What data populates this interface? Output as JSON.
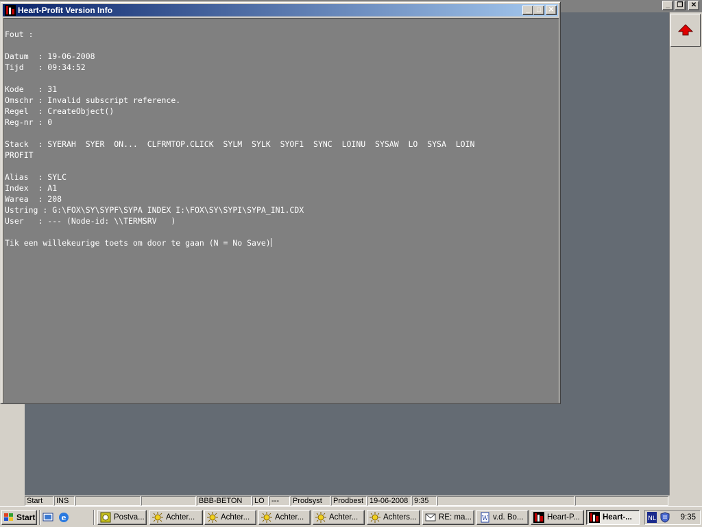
{
  "app": {
    "minimize_glyph": "_",
    "restore_glyph": "❐",
    "close_glyph": "✕"
  },
  "dialog": {
    "title": "Heart-Profit Version Info",
    "minimize_glyph": "_",
    "maximize_glyph": "□",
    "close_glyph": "✕",
    "lines": [
      "Fout :",
      "",
      "Datum  : 19-06-2008",
      "Tijd   : 09:34:52",
      "",
      "Kode   : 31",
      "Omschr : Invalid subscript reference.",
      "Regel  : CreateObject()",
      "Reg-nr : 0",
      "",
      "Stack  : SYERAH  SYER  ON...  CLFRMTOP.CLICK  SYLM  SYLK  SYOF1  SYNC  LOINU  SYSAW  LO  SYSA  LOIN",
      "PROFIT",
      "",
      "Alias  : SYLC",
      "Index  : A1",
      "Warea  : 208",
      "Ustring : G:\\FOX\\SY\\SYPF\\SYPA INDEX I:\\FOX\\SY\\SYPI\\SYPA_IN1.CDX",
      "User   : --- (Node-id: \\\\TERMSRV   )",
      "",
      "Tik een willekeurige toets om door te gaan (N = No Save)"
    ]
  },
  "statusbar": {
    "cells": [
      "Start",
      "INS",
      "",
      "",
      "BBB-BETON",
      "LO",
      "---",
      "Prodsyst",
      "Prodbest",
      "19-06-2008",
      "9:35",
      "",
      ""
    ]
  },
  "taskbar": {
    "start_label": "Start",
    "buttons": [
      "Postva...",
      "Achter...",
      "Achter...",
      "Achter...",
      "Achter...",
      "Achters...",
      "RE: ma...",
      "v.d. Bo...",
      "Heart-P...",
      "Heart-..."
    ],
    "clock": "9:35"
  },
  "colors": {
    "titlebar_start": "#0a246a",
    "titlebar_end": "#a6caf0",
    "console_bg": "#808080",
    "workspace_bg": "#646b73",
    "arrow_red": "#e00000"
  }
}
